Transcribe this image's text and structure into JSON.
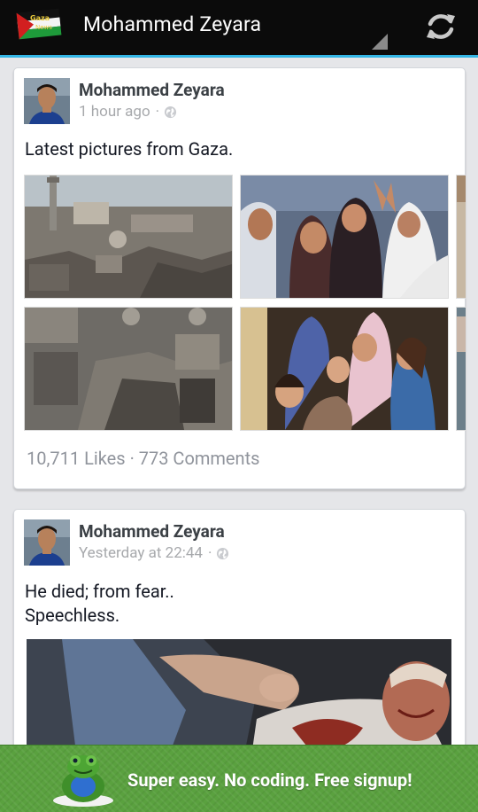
{
  "app": {
    "title": "Mohammed Zeyara",
    "logo_label": "Gaza News"
  },
  "feed": {
    "posts": [
      {
        "author": "Mohammed Zeyara",
        "time": "1 hour ago",
        "separator": "·",
        "privacy_icon": "globe-icon",
        "text_lines": [
          "Latest pictures from Gaza."
        ],
        "photos": [
          "photo-rubble-city",
          "photo-grieving-women",
          "photo-partial",
          "photo-destroyed-buildings",
          "photo-crying-children",
          "photo-partial"
        ],
        "stats": "10,711 Likes · 773 Comments"
      },
      {
        "author": "Mohammed Zeyara",
        "time": "Yesterday at 22:44",
        "separator": "·",
        "privacy_icon": "globe-icon",
        "text_lines": [
          "He died; from fear..",
          "Speechless."
        ],
        "photos": [
          "photo-injured-child"
        ]
      }
    ]
  },
  "banner": {
    "text": "Super easy. No coding. Free signup!"
  },
  "colors": {
    "actionbar": "#0b0b0b",
    "accent_line": "#33b5e5",
    "feed_bg": "#e5e6e9",
    "banner_green": "#5aa13f"
  }
}
